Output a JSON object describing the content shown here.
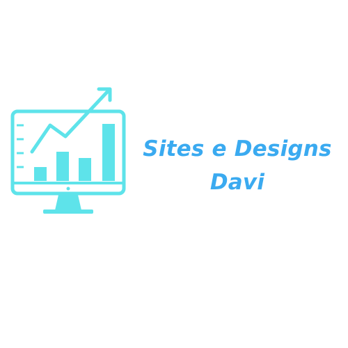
{
  "brand": {
    "name_line1": "Sites e Designs",
    "name_line2": "Davi",
    "tagline": "",
    "accent_color": "#3aaaf0",
    "icon_color": "#5ee3ea",
    "icon": "monitor-growth-chart-icon"
  }
}
